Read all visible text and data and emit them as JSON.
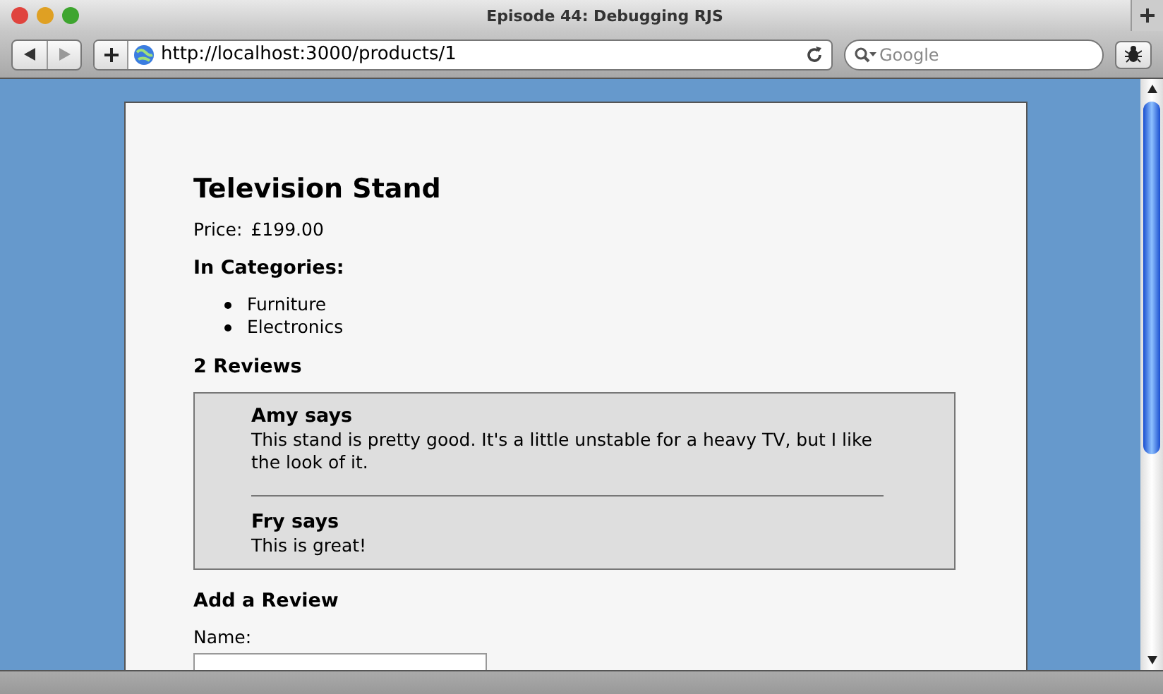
{
  "window": {
    "title": "Episode 44: Debugging RJS"
  },
  "toolbar": {
    "address": "http://localhost:3000/products/1",
    "search": {
      "placeholder": "Google"
    }
  },
  "page": {
    "title": "Television Stand",
    "price_label": "Price:",
    "price": "£199.00",
    "categories_heading": "In Categories:",
    "categories": [
      "Furniture",
      "Electronics"
    ],
    "reviews_heading": "2 Reviews",
    "reviews": [
      {
        "author": "Amy says",
        "body": "This stand is pretty good. It's a little unstable for a heavy TV, but I like the look of it."
      },
      {
        "author": "Fry says",
        "body": "This is great!"
      }
    ],
    "form": {
      "heading": "Add a Review",
      "name_label": "Name:"
    }
  }
}
